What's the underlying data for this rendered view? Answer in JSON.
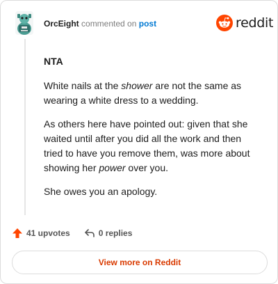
{
  "header": {
    "username": "OrcEight",
    "action_text": "commented on",
    "post_link": "post",
    "brand": "reddit"
  },
  "comment": {
    "heading": "NTA",
    "p1_before": "White nails at the ",
    "p1_em": "shower",
    "p1_after": " are not the same as wearing a white dress to a wedding.",
    "p2_before": "As others here have pointed out: given that she waited until after you did all the work and then tried to have you remove them, was more about showing her ",
    "p2_em": "power",
    "p2_after": " over you.",
    "p3": "She owes you an apology."
  },
  "actions": {
    "upvotes": "41 upvotes",
    "replies": "0 replies"
  },
  "footer": {
    "view_more": "View more on Reddit"
  },
  "colors": {
    "brand_orange": "#ff4500",
    "link_blue": "#0079d3",
    "cta_text": "#d93a00"
  },
  "icons": {
    "avatar": "avatar-image",
    "logo": "reddit-snoo-icon",
    "upvote": "upvote-arrow-icon",
    "reply": "reply-arrow-icon"
  }
}
